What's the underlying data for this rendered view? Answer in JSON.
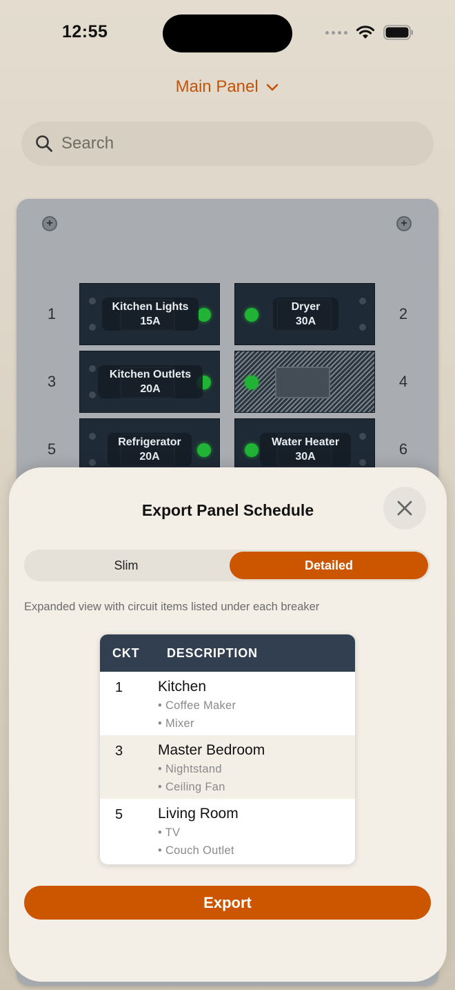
{
  "status_bar": {
    "time": "12:55"
  },
  "header": {
    "panel_name": "Main Panel"
  },
  "search": {
    "placeholder": "Search"
  },
  "breakers": [
    {
      "num": "1",
      "name": "Kitchen Lights",
      "amps": "15A"
    },
    {
      "num": "2",
      "name": "Dryer",
      "amps": "30A"
    },
    {
      "num": "3",
      "name": "Kitchen Outlets",
      "amps": "20A"
    },
    {
      "num": "4",
      "name": "",
      "amps": ""
    },
    {
      "num": "5",
      "name": "Refrigerator",
      "amps": "20A"
    },
    {
      "num": "6",
      "name": "Water Heater",
      "amps": "30A"
    }
  ],
  "sheet": {
    "title": "Export Panel Schedule",
    "segments": {
      "slim": "Slim",
      "detailed": "Detailed",
      "selected": "Detailed"
    },
    "description": "Expanded view with circuit items listed under each breaker",
    "table": {
      "headers": {
        "ckt": "CKT",
        "description": "DESCRIPTION"
      },
      "rows": [
        {
          "ckt": "1",
          "title": "Kitchen",
          "items": [
            "• Coffee Maker",
            "• Mixer"
          ]
        },
        {
          "ckt": "3",
          "title": "Master Bedroom",
          "items": [
            "• Nightstand",
            "• Ceiling Fan"
          ]
        },
        {
          "ckt": "5",
          "title": "Living Room",
          "items": [
            "• TV",
            "• Couch Outlet"
          ]
        }
      ]
    },
    "export_label": "Export"
  },
  "colors": {
    "accent": "#cc5500",
    "led": "#20b335",
    "table_header": "#323f51"
  }
}
